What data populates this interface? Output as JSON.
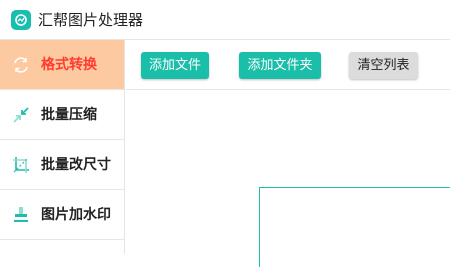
{
  "app": {
    "title": "汇帮图片处理器",
    "icon": "image-tool-icon"
  },
  "sidebar": {
    "items": [
      {
        "label": "格式转换",
        "icon": "format-convert-icon",
        "active": true
      },
      {
        "label": "批量压缩",
        "icon": "compress-icon",
        "active": false
      },
      {
        "label": "批量改尺寸",
        "icon": "resize-icon",
        "active": false
      },
      {
        "label": "图片加水印",
        "icon": "watermark-icon",
        "active": false
      }
    ]
  },
  "toolbar": {
    "add_file_label": "添加文件",
    "add_folder_label": "添加文件夹",
    "clear_list_label": "清空列表"
  },
  "colors": {
    "accent": "#1bbfa9",
    "active_bg": "#fdc9a1",
    "active_text": "#ff3c2f"
  }
}
